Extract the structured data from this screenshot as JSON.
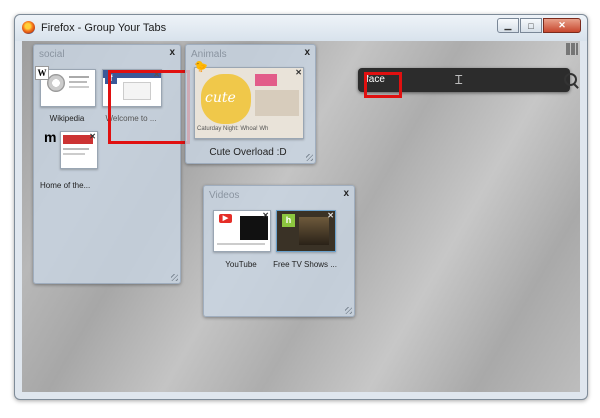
{
  "window": {
    "title": "Firefox - Group Your Tabs",
    "minimize_label": "▭",
    "maximize_label": "▢",
    "close_label": "x"
  },
  "search": {
    "value": "face"
  },
  "groups": {
    "social": {
      "title": "social",
      "close_label": "x",
      "tabs": {
        "wikipedia": {
          "label": "Wikipedia",
          "favicon": "W"
        },
        "facebook": {
          "label": "Welcome to ...",
          "favicon": "f"
        },
        "mozilla": {
          "label": "Home of the...",
          "favicon": "m"
        }
      }
    },
    "animals": {
      "title": "Animals",
      "close_label": "x",
      "tabs": {
        "cute": {
          "label": "Cute Overload :D",
          "thumb_text": "cute",
          "caption": "Caturday Night: Whoa! Wh"
        }
      }
    },
    "videos": {
      "title": "Videos",
      "close_label": "x",
      "tabs": {
        "youtube": {
          "label": "YouTube",
          "favicon": "▶"
        },
        "hulu": {
          "label": "Free TV Shows ...",
          "favicon": "h"
        }
      }
    }
  },
  "colors": {
    "highlight": "#e01010",
    "facebook_blue": "#3b5998",
    "youtube_red": "#e52d27",
    "hulu_green": "#8cc63f"
  }
}
